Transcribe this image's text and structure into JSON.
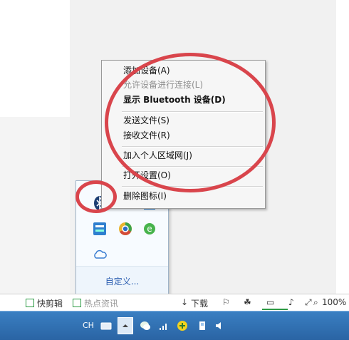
{
  "context_menu": {
    "items": [
      {
        "label": "添加设备(A)",
        "state": "normal"
      },
      {
        "label": "允许设备进行连接(L)",
        "state": "disabled"
      },
      {
        "label": "显示 Bluetooth 设备(D)",
        "state": "bold"
      },
      {
        "label": "发送文件(S)",
        "state": "normal"
      },
      {
        "label": "接收文件(R)",
        "state": "normal"
      },
      {
        "label": "加入个人区域网(J)",
        "state": "normal"
      },
      {
        "label": "打开设置(O)",
        "state": "normal"
      },
      {
        "label": "删除图标(I)",
        "state": "normal"
      }
    ]
  },
  "tray_popup": {
    "customize_label": "自定义...",
    "icons": [
      "bluetooth-icon",
      "network-device-icon",
      "monitor-icon",
      "app-shield-icon",
      "chrome-icon",
      "ie-icon",
      "cloud-icon"
    ]
  },
  "status_bar": {
    "quick_clip_label": "快剪辑",
    "news_label": "热点资讯",
    "download_label": "下载",
    "zoom_label": "100%"
  },
  "taskbar": {
    "language_label": "CH"
  },
  "colors": {
    "annotation_red": "#d9454c",
    "taskbar_blue": "#2f6fb3",
    "link_blue": "#2a5db0"
  }
}
